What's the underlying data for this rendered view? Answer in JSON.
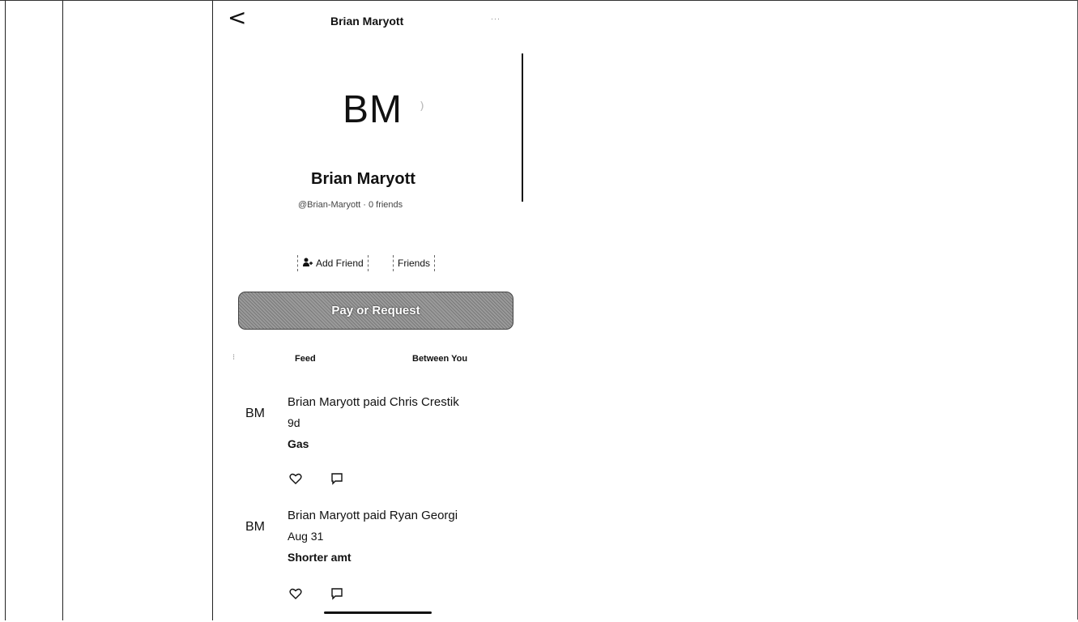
{
  "header": {
    "back_glyph": "<",
    "title": "Brian Maryott",
    "more_glyph": "···"
  },
  "profile": {
    "initials": "BM",
    "name": "Brian Maryott",
    "handle_line": "@Brian-Maryott · 0 friends",
    "add_friend_label": "Add Friend",
    "friends_label": "Friends"
  },
  "pay_button_label": "Pay or Request",
  "tabs": [
    {
      "label": "Feed"
    },
    {
      "label": "Between You"
    }
  ],
  "feed": [
    {
      "initials": "BM",
      "title": "Brian Maryott paid Chris Crestik",
      "date": "9d",
      "note": "Gas"
    },
    {
      "initials": "BM",
      "title": "Brian Maryott paid Ryan Georgi",
      "date": "Aug 31",
      "note": "Shorter amt"
    }
  ]
}
